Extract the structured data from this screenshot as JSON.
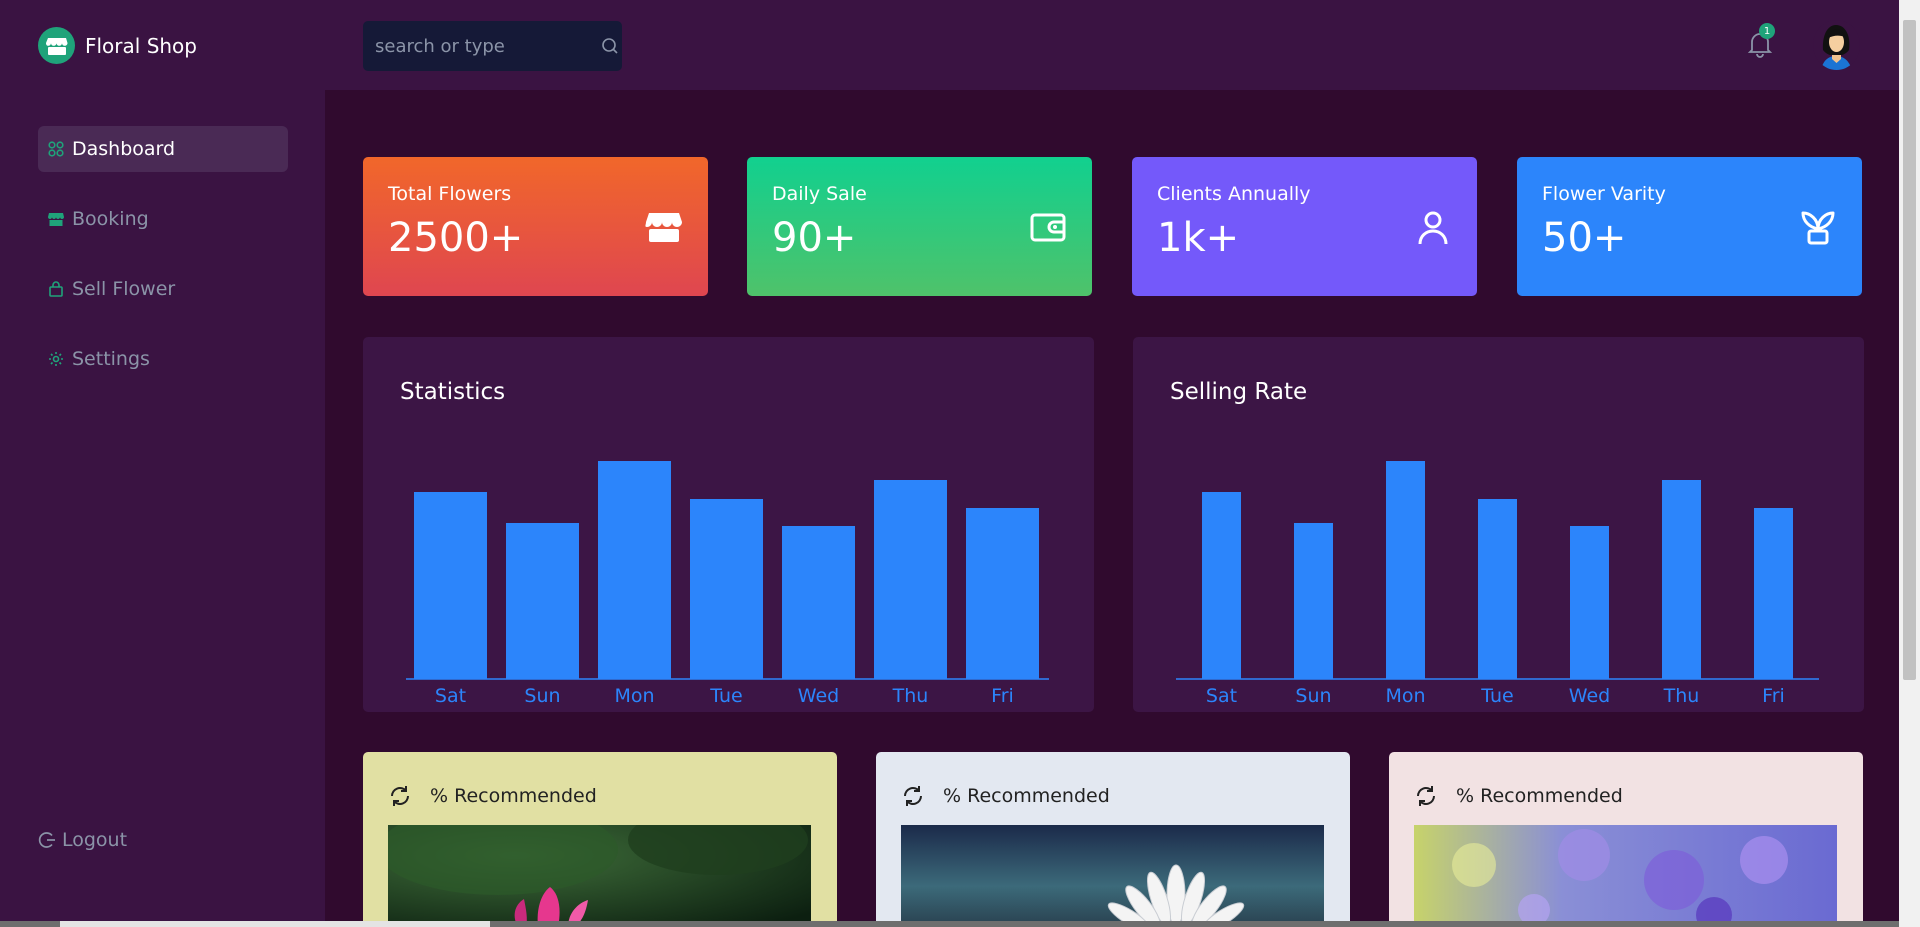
{
  "brand": {
    "name": "Floral Shop",
    "icon": "store-icon",
    "color": "#1fa37a"
  },
  "sidebar": {
    "items": [
      {
        "label": "Dashboard",
        "icon": "grid-icon",
        "active": true
      },
      {
        "label": "Booking",
        "icon": "store-icon",
        "active": false
      },
      {
        "label": "Sell Flower",
        "icon": "lock-bag-icon",
        "active": false
      },
      {
        "label": "Settings",
        "icon": "gear-icon",
        "active": false
      }
    ],
    "logout_label": "Logout"
  },
  "header": {
    "search_placeholder": "search or type",
    "notification_count": "1"
  },
  "stats": [
    {
      "title": "Total Flowers",
      "value": "2500+",
      "icon": "store-icon"
    },
    {
      "title": "Daily Sale",
      "value": "90+",
      "icon": "wallet-icon"
    },
    {
      "title": "Clients Annually",
      "value": "1k+",
      "icon": "user-icon"
    },
    {
      "title": "Flower Varity",
      "value": "50+",
      "icon": "plant-icon"
    }
  ],
  "chart_data": [
    {
      "type": "bar",
      "title": "Statistics",
      "categories": [
        "Sat",
        "Sun",
        "Mon",
        "Tue",
        "Wed",
        "Thu",
        "Fri"
      ],
      "values": [
        187,
        156,
        218,
        180,
        153,
        199,
        171
      ],
      "ylim": [
        0,
        218
      ],
      "grid": false,
      "color": "#2c85fb"
    },
    {
      "type": "bar",
      "title": "Selling Rate",
      "categories": [
        "Sat",
        "Sun",
        "Mon",
        "Tue",
        "Wed",
        "Thu",
        "Fri"
      ],
      "values": [
        187,
        156,
        218,
        180,
        153,
        199,
        171
      ],
      "ylim": [
        0,
        218
      ],
      "grid": false,
      "color": "#2c85fb"
    }
  ],
  "recommended": [
    {
      "label": "% Recommended",
      "icon": "refresh-icon",
      "image": "pink-lotus-flower-image"
    },
    {
      "label": "% Recommended",
      "icon": "refresh-icon",
      "image": "white-daisy-flower-image"
    },
    {
      "label": "% Recommended",
      "icon": "refresh-icon",
      "image": "purple-lavender-flowers-image"
    }
  ]
}
